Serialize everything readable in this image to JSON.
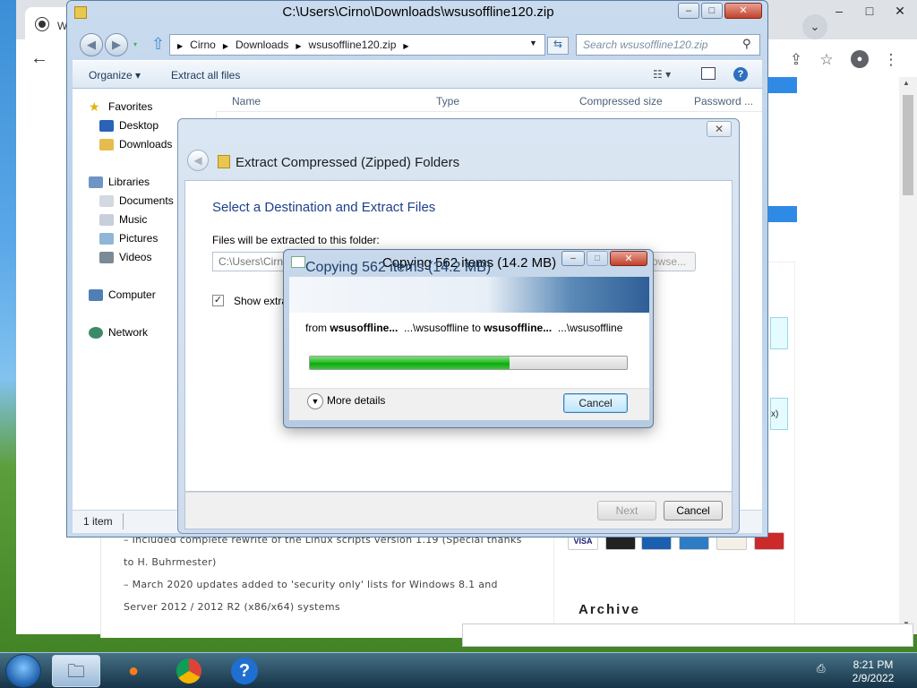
{
  "chrome": {
    "tab_title": "W",
    "window_buttons": [
      "–",
      "□",
      "✕"
    ],
    "article_lines": [
      "– Included complete rewrite of the Linux scripts version 1.19 (Special thanks",
      "to H. Buhrmester)",
      "– March 2020 updates added to 'security only' lists for Windows 8.1 and",
      "Server 2012 / 2012 R2 (x86/x64) systems"
    ],
    "sidebar_heading": "Archive",
    "cyan_box_text": "x)",
    "cards": [
      "VISA",
      "",
      "",
      "",
      "",
      ""
    ],
    "icons": {
      "back": "arrow-left-icon",
      "share": "share-icon",
      "bookmark": "star-icon",
      "profile": "profile-icon",
      "menu": "kebab-menu-icon",
      "tabsearch": "chevron-down-icon"
    }
  },
  "explorer": {
    "title": "C:\\Users\\Cirno\\Downloads\\wsusoffline120.zip",
    "breadcrumb": [
      "Cirno",
      "Downloads",
      "wsusoffline120.zip"
    ],
    "search_placeholder": "Search wsusoffline120.zip",
    "commands": {
      "organize": "Organize ▾",
      "extract_all": "Extract all files"
    },
    "columns": [
      "Name",
      "Type",
      "Compressed size",
      "Password ..."
    ],
    "nav": {
      "favorites": "Favorites",
      "desktop": "Desktop",
      "downloads": "Downloads",
      "libraries": "Libraries",
      "documents": "Documents",
      "music": "Music",
      "pictures": "Pictures",
      "videos": "Videos",
      "computer": "Computer",
      "network": "Network"
    },
    "status": "1 item"
  },
  "wizard": {
    "title": "Extract Compressed (Zipped) Folders",
    "heading": "Select a Destination and Extract Files",
    "dest_label": "Files will be extracted to this folder:",
    "dest_value": "C:\\Users\\Cirno",
    "browse_label": "owse...",
    "show_label": "Show extra",
    "next_label": "Next",
    "cancel_label": "Cancel"
  },
  "copy": {
    "caption": "Copying 562 items (14.2 MB)",
    "banner": "Copying 562 items (14.2 MB)",
    "from_word": "from",
    "src_name": "wsusoffline...",
    "src_path": "...\\wsusoffline",
    "to_word": "to",
    "dst_name": "wsusoffline...",
    "dst_path": "...\\wsusoffline",
    "progress_percent": 63,
    "more_details": "More details",
    "cancel_label": "Cancel"
  },
  "taskbar": {
    "time": "8:21 PM",
    "date": "2/9/2022",
    "apps": [
      "explorer-icon",
      "firefox-icon",
      "chrome-icon",
      "help-icon"
    ]
  }
}
